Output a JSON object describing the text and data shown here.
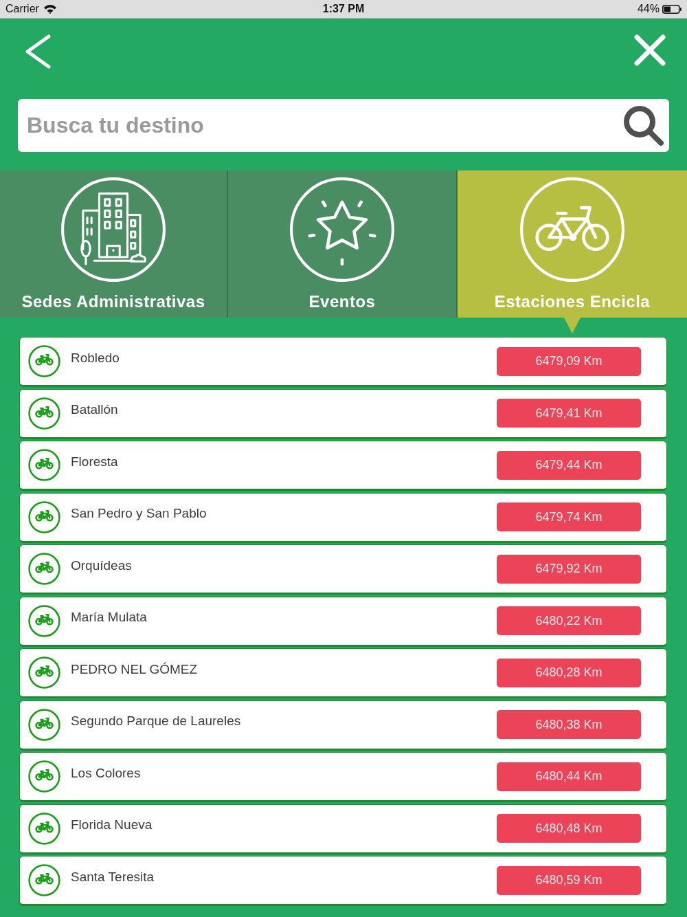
{
  "status_bar": {
    "carrier": "Carrier",
    "time": "1:37 PM",
    "battery": "44%"
  },
  "search": {
    "placeholder": "Busca tu destino"
  },
  "categories": [
    {
      "label": "Sedes Administrativas",
      "kind": "buildings",
      "selected": false
    },
    {
      "label": "Eventos",
      "kind": "star",
      "selected": false
    },
    {
      "label": "Estaciones Encicla",
      "kind": "bicycle",
      "selected": true
    }
  ],
  "stations": [
    {
      "name": "Robledo",
      "distance": "6479,09 Km"
    },
    {
      "name": "Batallón",
      "distance": "6479,41 Km"
    },
    {
      "name": "Floresta",
      "distance": "6479,44 Km"
    },
    {
      "name": "San Pedro y San Pablo",
      "distance": "6479,74 Km"
    },
    {
      "name": "Orquídeas",
      "distance": "6479,92 Km"
    },
    {
      "name": "María Mulata",
      "distance": "6480,22 Km"
    },
    {
      "name": "PEDRO NEL GÓMEZ",
      "distance": "6480,28 Km"
    },
    {
      "name": "Segundo Parque de Laureles",
      "distance": "6480,38 Km"
    },
    {
      "name": "Los Colores",
      "distance": "6480,44 Km"
    },
    {
      "name": "Florida Nueva",
      "distance": "6480,48 Km"
    },
    {
      "name": "Santa Teresita",
      "distance": "6480,59 Km"
    }
  ]
}
